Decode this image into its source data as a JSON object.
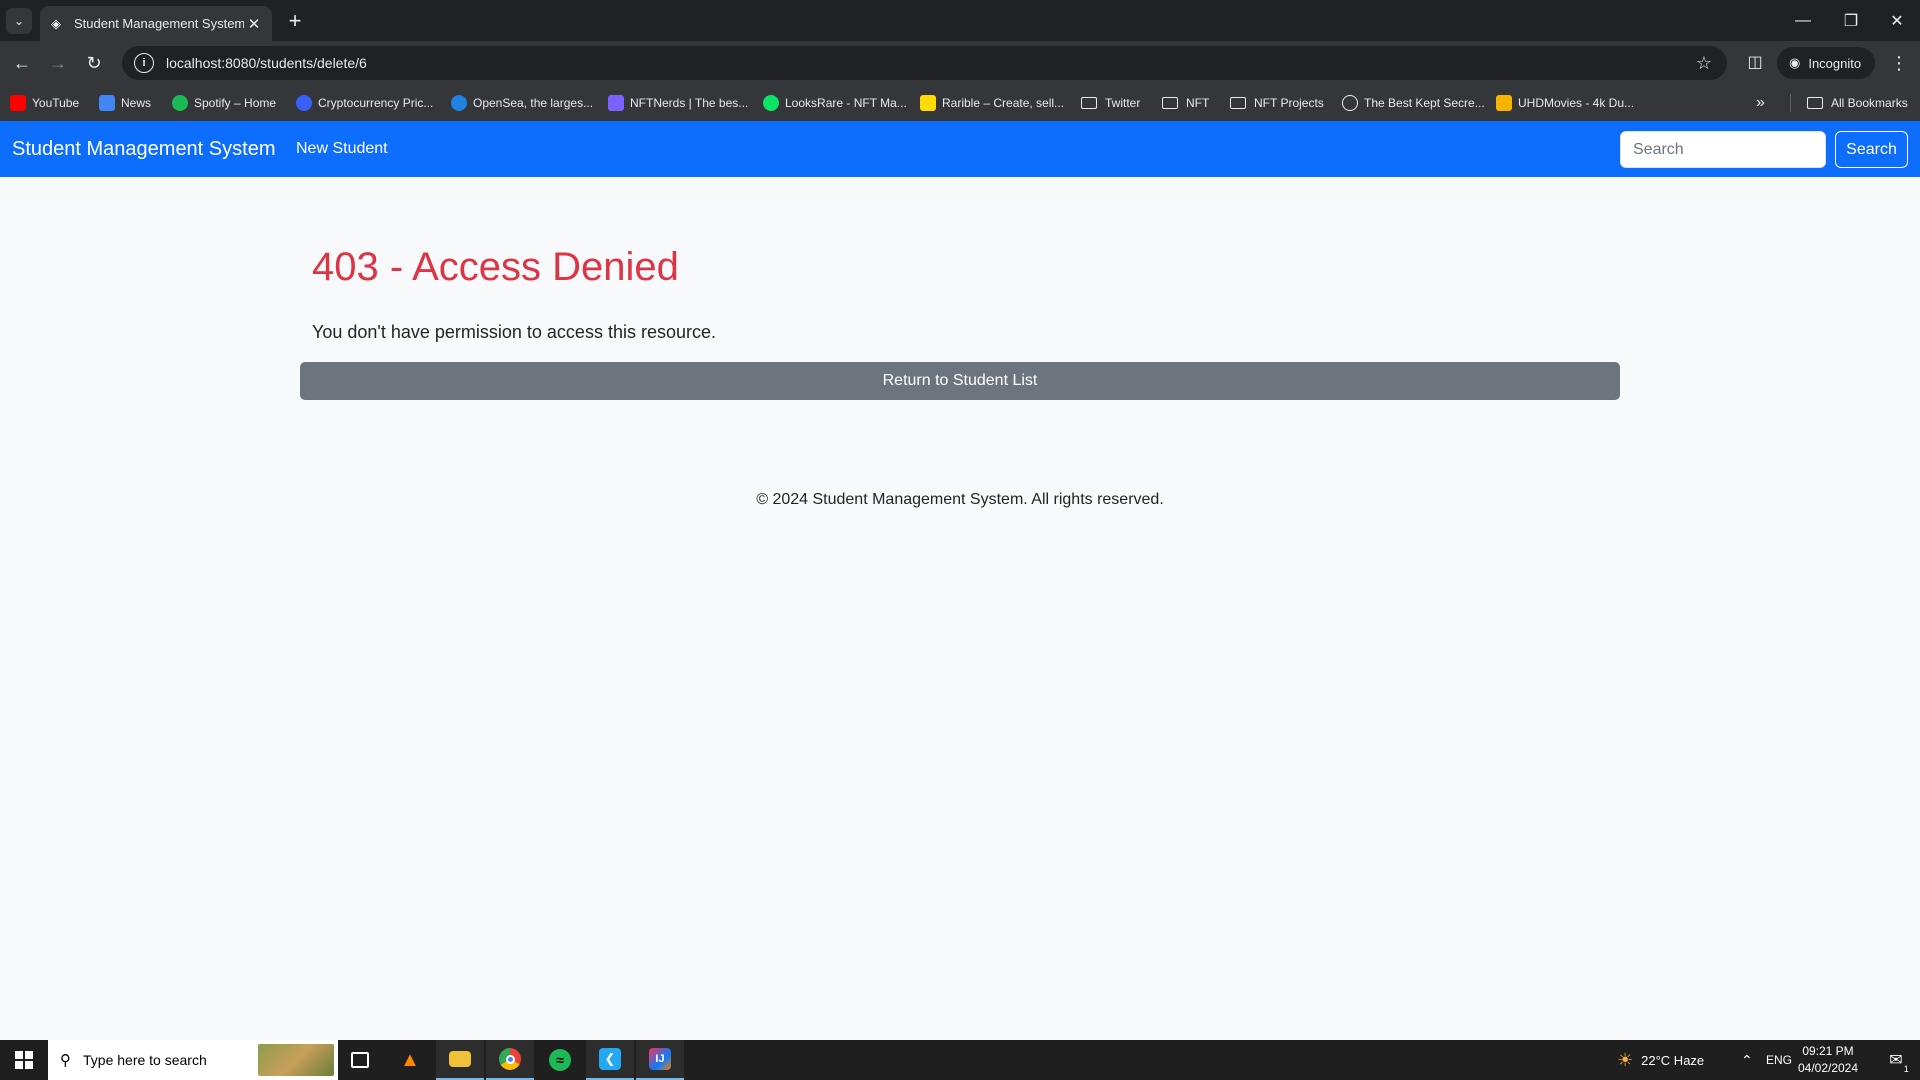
{
  "browser": {
    "tab_title": "Student Management System -",
    "url": "localhost:8080/students/delete/6",
    "profile_label": "Incognito",
    "bookmarks": [
      {
        "label": "YouTube",
        "icon": "youtube-icon",
        "color": "#ff0000"
      },
      {
        "label": "News",
        "icon": "news-icon",
        "color": "#4285f4"
      },
      {
        "label": "Spotify – Home",
        "icon": "spotify-icon",
        "color": "#1db954"
      },
      {
        "label": "Cryptocurrency Pric...",
        "icon": "coinmarketcap-icon",
        "color": "#3861fb"
      },
      {
        "label": "OpenSea, the larges...",
        "icon": "opensea-icon",
        "color": "#2081e2"
      },
      {
        "label": "NFTNerds | The bes...",
        "icon": "nftnerds-icon",
        "color": "#7b61ff"
      },
      {
        "label": "LooksRare - NFT Ma...",
        "icon": "looksrare-icon",
        "color": "#0ce466"
      },
      {
        "label": "Rarible – Create, sell...",
        "icon": "rarible-icon",
        "color": "#feda03"
      },
      {
        "label": "Twitter",
        "icon": "folder-icon"
      },
      {
        "label": "NFT",
        "icon": "folder-icon"
      },
      {
        "label": "NFT Projects",
        "icon": "folder-icon"
      },
      {
        "label": "The Best Kept Secre...",
        "icon": "globe-icon"
      },
      {
        "label": "UHDMovies - 4k Du...",
        "icon": "uhdmovies-icon",
        "color": "#f4b400"
      }
    ],
    "all_bookmarks_label": "All Bookmarks"
  },
  "navbar": {
    "brand": "Student Management System",
    "new_student": "New Student",
    "search_placeholder": "Search",
    "search_button": "Search",
    "color": "#0d6efd"
  },
  "main": {
    "error_title": "403 - Access Denied",
    "error_message": "You don't have permission to access this resource.",
    "return_button": "Return to Student List"
  },
  "footer": {
    "text": "© 2024 Student Management System. All rights reserved."
  },
  "taskbar": {
    "search_placeholder": "Type here to search",
    "weather": "22°C  Haze",
    "language": "ENG",
    "time": "09:21 PM",
    "date": "04/02/2024",
    "notification_count": "1"
  }
}
